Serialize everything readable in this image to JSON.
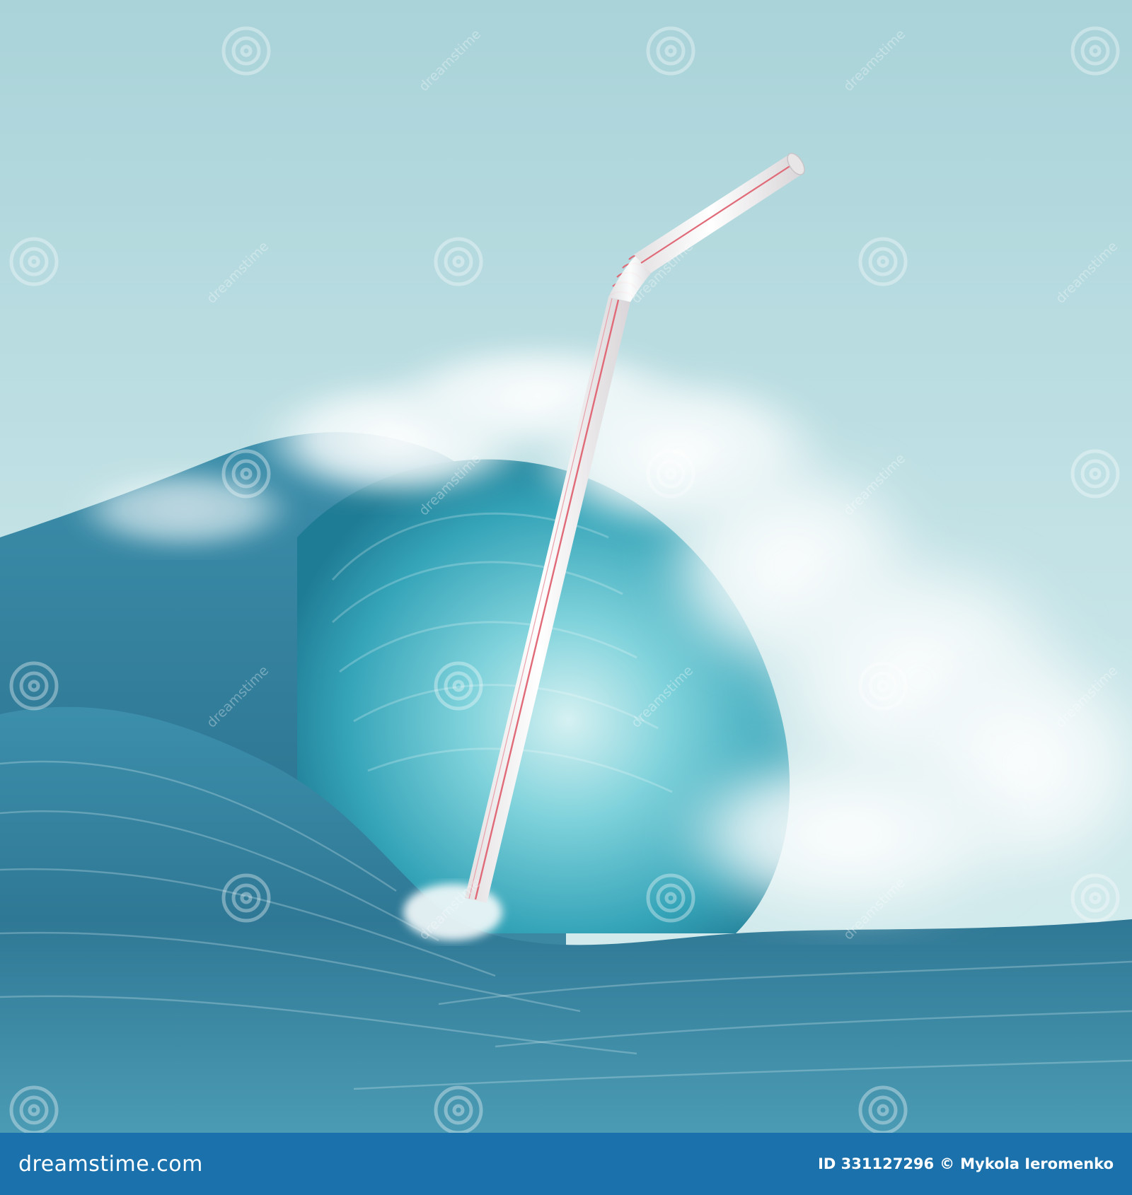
{
  "footer": {
    "brand": "dreamstime.com",
    "id_label": "ID 331127296",
    "copyright_symbol": "©",
    "author": "Mykola Ieromenko"
  },
  "watermark": {
    "text": "dreamstime"
  },
  "colors": {
    "sky": "#bfe0e4",
    "sea_deep": "#2b6f8c",
    "sea_mid": "#3d93ad",
    "barrel": "#5fc3cf",
    "foam": "#f2f8f9",
    "straw": "#f6f4f4",
    "straw_stripe": "#e06a78",
    "footer_bar": "#1b71ab"
  }
}
